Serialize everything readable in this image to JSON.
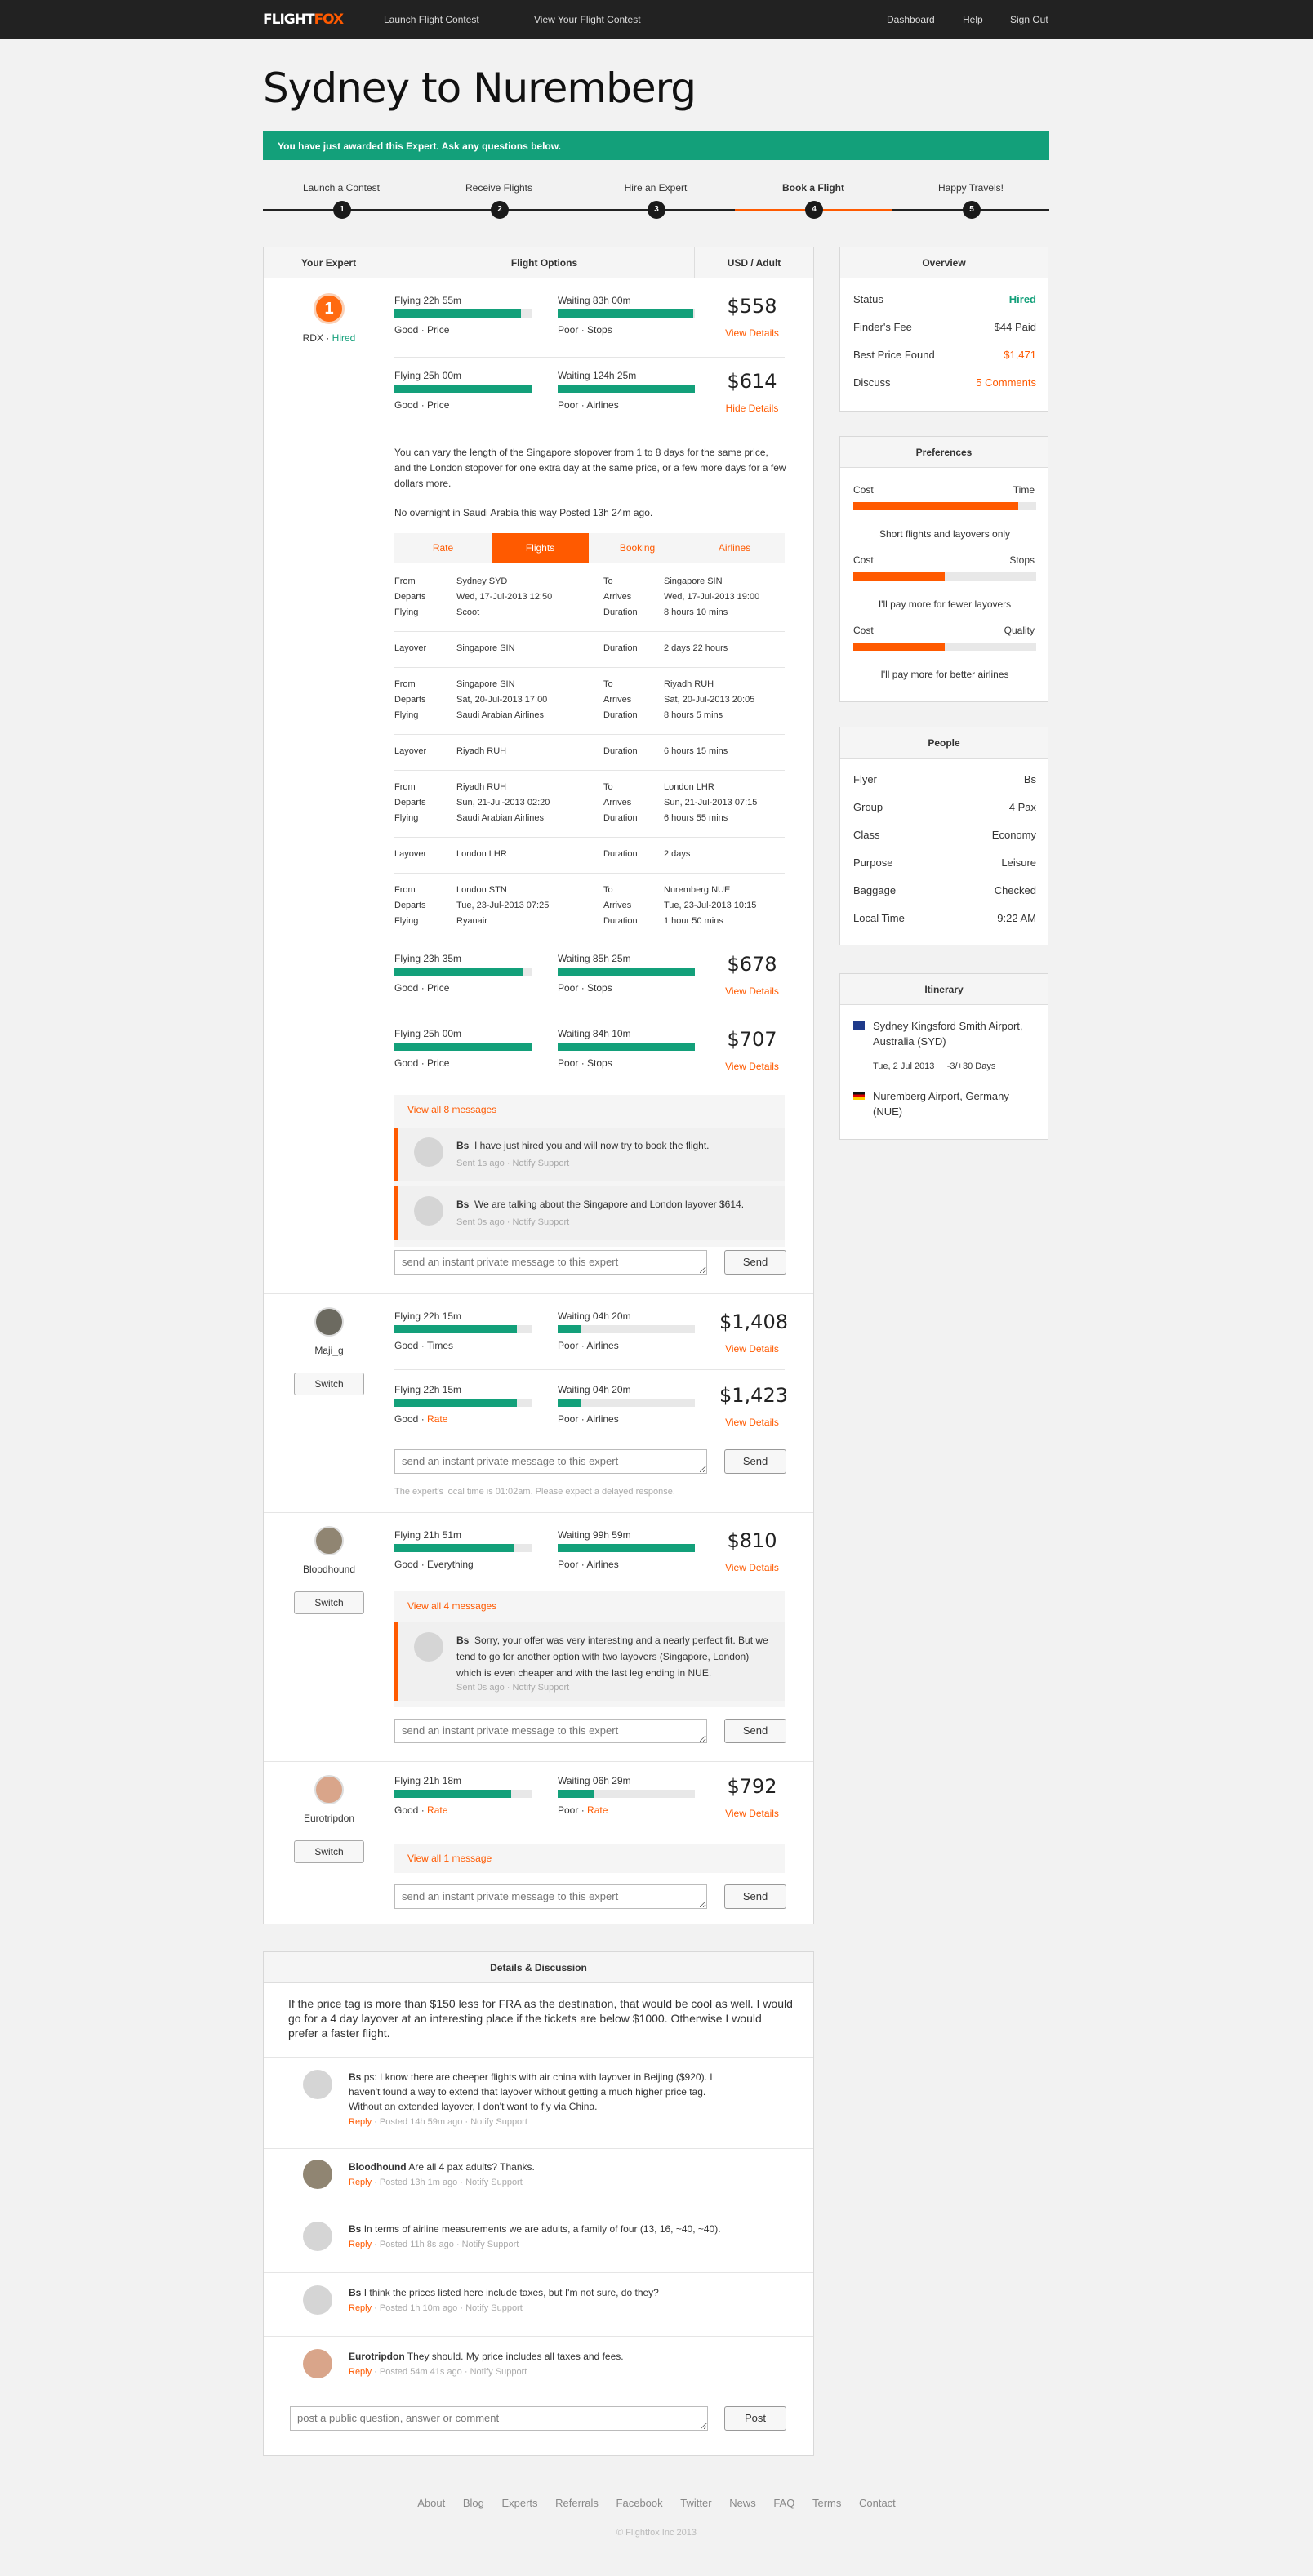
{
  "nav": {
    "logo_a": "FLIGHT",
    "logo_b": "FOX",
    "launch": "Launch Flight Contest",
    "view": "View Your Flight Contest",
    "dashboard": "Dashboard",
    "help": "Help",
    "signout": "Sign Out"
  },
  "page_title": "Sydney to Nuremberg",
  "banner": "You have just awarded this Expert. Ask any questions below.",
  "steps": [
    {
      "label": "Launch a Contest",
      "n": "1"
    },
    {
      "label": "Receive Flights",
      "n": "2"
    },
    {
      "label": "Hire an Expert",
      "n": "3"
    },
    {
      "label": "Book a Flight",
      "n": "4"
    },
    {
      "label": "Happy Travels!",
      "n": "5"
    }
  ],
  "colors": {
    "accent": "#ff5a00",
    "green": "#13a07a"
  },
  "table": {
    "h_expert": "Your Expert",
    "h_options": "Flight Options",
    "h_price": "USD / Adult"
  },
  "experts": [
    {
      "badge": "1",
      "name": "RDX",
      "status": "Hired",
      "options": [
        {
          "flying": "Flying 22h 55m",
          "waiting": "Waiting 83h 00m",
          "s1a": "Good",
          "s1b": "Price",
          "s2a": "Poor",
          "s2b": "Stops",
          "price": "$558",
          "link": "View Details",
          "fly_pct": 0.92,
          "wait_pct": 0.99
        },
        {
          "flying": "Flying 25h 00m",
          "waiting": "Waiting 124h 25m",
          "s1a": "Good",
          "s1b": "Price",
          "s2a": "Poor",
          "s2b": "Airlines",
          "price": "$614",
          "link": "Hide Details",
          "fly_pct": 1.0,
          "wait_pct": 1.0
        },
        {
          "flying": "Flying 23h 35m",
          "waiting": "Waiting 85h 25m",
          "s1a": "Good",
          "s1b": "Price",
          "s2a": "Poor",
          "s2b": "Stops",
          "price": "$678",
          "link": "View Details",
          "fly_pct": 0.94,
          "wait_pct": 1.0
        },
        {
          "flying": "Flying 25h 00m",
          "waiting": "Waiting 84h 10m",
          "s1a": "Good",
          "s1b": "Price",
          "s2a": "Poor",
          "s2b": "Stops",
          "price": "$707",
          "link": "View Details",
          "fly_pct": 1.0,
          "wait_pct": 1.0
        }
      ],
      "description": "You can vary the length of the Singapore stopover from 1 to 8 days for the same price, and the London stopover for one extra day at the same price, or a few more days for a few dollars more.",
      "posted": "No overnight in Saudi Arabia this way Posted 13h 24m ago.",
      "tabs": [
        "Rate",
        "Flights",
        "Booking",
        "Airlines"
      ],
      "legs": [
        {
          "type": "flight",
          "from": "Sydney SYD",
          "departs": "Wed, 17-Jul-2013 12:50",
          "flying": "Scoot",
          "to": "Singapore SIN",
          "arrives": "Wed, 17-Jul-2013 19:00",
          "duration": "8 hours 10 mins"
        },
        {
          "type": "layover",
          "place": "Singapore SIN",
          "duration": "2 days 22 hours"
        },
        {
          "type": "flight",
          "from": "Singapore SIN",
          "departs": "Sat, 20-Jul-2013 17:00",
          "flying": "Saudi Arabian Airlines",
          "to": "Riyadh RUH",
          "arrives": "Sat, 20-Jul-2013 20:05",
          "duration": "8 hours 5 mins"
        },
        {
          "type": "layover",
          "place": "Riyadh RUH",
          "duration": "6 hours 15 mins"
        },
        {
          "type": "flight",
          "from": "Riyadh RUH",
          "departs": "Sun, 21-Jul-2013 02:20",
          "flying": "Saudi Arabian Airlines",
          "to": "London LHR",
          "arrives": "Sun, 21-Jul-2013 07:15",
          "duration": "6 hours 55 mins"
        },
        {
          "type": "layover",
          "place": "London LHR",
          "duration": "2 days"
        },
        {
          "type": "flight",
          "from": "London STN",
          "departs": "Tue, 23-Jul-2013 07:25",
          "flying": "Ryanair",
          "to": "Nuremberg NUE",
          "arrives": "Tue, 23-Jul-2013 10:15",
          "duration": "1 hour 50 mins"
        }
      ],
      "leg_labels": {
        "from": "From",
        "departs": "Departs",
        "flying": "Flying",
        "to": "To",
        "arrives": "Arrives",
        "duration": "Duration",
        "layover": "Layover"
      },
      "view_all": "View all 8 messages",
      "messages": [
        {
          "author": "Bs",
          "text": "I have just hired you and will now try to book the flight.",
          "meta": "Sent 1s ago · Notify Support"
        },
        {
          "author": "Bs",
          "text": "We are talking about the Singapore and London layover $614.",
          "meta": "Sent 0s ago · Notify Support"
        }
      ]
    },
    {
      "name": "Maji_g",
      "switch": "Switch",
      "options": [
        {
          "flying": "Flying 22h 15m",
          "waiting": "Waiting 04h 20m",
          "s1a": "Good",
          "s1b": "Times",
          "s2a": "Poor",
          "s2b": "Airlines",
          "price": "$1,408",
          "link": "View Details",
          "fly_pct": 0.89,
          "wait_pct": 0.17
        },
        {
          "flying": "Flying 22h 15m",
          "waiting": "Waiting 04h 20m",
          "s1a": "Good",
          "s1b": "Rate",
          "s2a": "Poor",
          "s2b": "Airlines",
          "price": "$1,423",
          "link": "View Details",
          "fly_pct": 0.89,
          "wait_pct": 0.17
        }
      ],
      "note": "The expert's local time is 01:02am. Please expect a delayed response."
    },
    {
      "name": "Bloodhound",
      "switch": "Switch",
      "options": [
        {
          "flying": "Flying 21h 51m",
          "waiting": "Waiting 99h 59m",
          "s1a": "Good",
          "s1b": "Everything",
          "s2a": "Poor",
          "s2b": "Airlines",
          "price": "$810",
          "link": "View Details",
          "fly_pct": 0.87,
          "wait_pct": 1.0
        }
      ],
      "view_all": "View all 4 messages",
      "messages": [
        {
          "author": "Bs",
          "text": "Sorry, your offer was very interesting and a nearly perfect fit. But we tend to go for another option with two layovers (Singapore, London) which is even cheaper and with the last leg ending in NUE.",
          "meta": "Sent 0s ago · Notify Support"
        }
      ]
    },
    {
      "name": "Eurotripdon",
      "switch": "Switch",
      "options": [
        {
          "flying": "Flying 21h 18m",
          "waiting": "Waiting 06h 29m",
          "s1a": "Good",
          "s1b": "Rate",
          "s2a": "Poor",
          "s2b": "Rate",
          "price": "$792",
          "link": "View Details",
          "fly_pct": 0.85,
          "wait_pct": 0.26
        }
      ],
      "view_all": "View all 1 message"
    }
  ],
  "input_placeholder": "send an instant private message to this expert",
  "send": "Send",
  "overview": {
    "title": "Overview",
    "rows": [
      {
        "k": "Status",
        "v": "Hired"
      },
      {
        "k": "Finder's Fee",
        "v": "$44 Paid"
      },
      {
        "k": "Best Price Found",
        "v": "$1,471"
      },
      {
        "k": "Discuss",
        "v": "5 Comments"
      }
    ]
  },
  "preferences": {
    "title": "Preferences",
    "items": [
      {
        "left": "Cost",
        "right": "Time",
        "caption": "Short flights and layovers only",
        "level": 0.9
      },
      {
        "left": "Cost",
        "right": "Stops",
        "caption": "I'll pay more for fewer layovers",
        "level": 0.5
      },
      {
        "left": "Cost",
        "right": "Quality",
        "caption": "I'll pay more for better airlines",
        "level": 0.5
      }
    ]
  },
  "people": {
    "title": "People",
    "rows": [
      {
        "k": "Flyer",
        "v": "Bs"
      },
      {
        "k": "Group",
        "v": "4 Pax"
      },
      {
        "k": "Class",
        "v": "Economy"
      },
      {
        "k": "Purpose",
        "v": "Leisure"
      },
      {
        "k": "Baggage",
        "v": "Checked"
      },
      {
        "k": "Local Time",
        "v": "9:22 AM"
      }
    ]
  },
  "itinerary": {
    "title": "Itinerary",
    "origin": "Sydney Kingsford Smith Airport, Australia (SYD)",
    "date": "Tue, 2 Jul 2013",
    "flex": "-3/+30 Days",
    "destination": "Nuremberg Airport, Germany (NUE)"
  },
  "discussion": {
    "title": "Details & Discussion",
    "question": "If the price tag is more than $150 less for FRA as the destination, that would be cool as well. I would go for a 4 day layover at an interesting place if the tickets are below $1000. Otherwise I would prefer a faster flight.",
    "comments": [
      {
        "author": "Bs",
        "text": "ps: I know there are cheeper flights with air china with layover in Beijing ($920). I haven't found a way to extend that layover without getting a much higher price tag. Without an extended layover, I don't want to fly via China.",
        "reply": "Reply",
        "meta": " · Posted 14h 59m ago · Notify Support"
      },
      {
        "author": "Bloodhound",
        "text": "Are all 4 pax adults? Thanks.",
        "reply": "Reply",
        "meta": " · Posted 13h 1m ago · Notify Support"
      },
      {
        "author": "Bs",
        "text": "In terms of airline measurements we are adults, a family of four (13, 16, ~40, ~40).",
        "reply": "Reply",
        "meta": " · Posted 11h 8s ago · Notify Support"
      },
      {
        "author": "Bs",
        "text": "I think the prices listed here include taxes, but I'm not sure, do they?",
        "reply": "Reply",
        "meta": " · Posted 1h 10m ago · Notify Support"
      },
      {
        "author": "Eurotripdon",
        "text": "They should. My price includes all taxes and fees.",
        "reply": "Reply",
        "meta": " · Posted 54m 41s ago · Notify Support"
      }
    ],
    "input_placeholder": "post a public question, answer or comment",
    "post": "Post"
  },
  "footer": {
    "links": [
      "About",
      "Blog",
      "Experts",
      "Referrals",
      "Facebook",
      "Twitter",
      "News",
      "FAQ",
      "Terms",
      "Contact"
    ],
    "copy": "© Flightfox Inc 2013"
  }
}
